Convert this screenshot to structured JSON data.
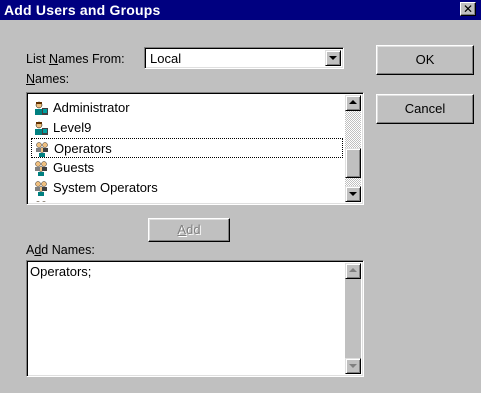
{
  "window": {
    "title": "Add Users and Groups",
    "close_glyph": "✕"
  },
  "list_names_from": {
    "label_pre": "List ",
    "label_key": "N",
    "label_post": "ames From:",
    "selected": "Local"
  },
  "names": {
    "label_key": "N",
    "label_post": "ames:",
    "items": [
      {
        "label": "Administrator",
        "icon": "single-user-icon"
      },
      {
        "label": "Level9",
        "icon": "single-user-icon"
      },
      {
        "label": "Operators",
        "icon": "group-icon"
      },
      {
        "label": "Guests",
        "icon": "group-icon"
      },
      {
        "label": "System Operators",
        "icon": "group-icon"
      },
      {
        "label": "...",
        "icon": "group-icon"
      }
    ],
    "focused_index": 2
  },
  "add_button": {
    "label_key": "A",
    "label_post": "dd"
  },
  "add_names": {
    "label_pre": "A",
    "label_key": "d",
    "label_post": "d Names:",
    "value": "Operators;"
  },
  "buttons": {
    "ok": "OK",
    "cancel": "Cancel"
  },
  "colors": {
    "titlebar": "#000080",
    "face": "#c0c0c0"
  }
}
